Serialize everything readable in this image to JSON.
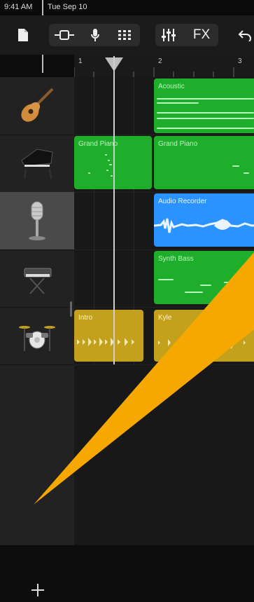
{
  "status": {
    "time": "9:41 AM",
    "date": "Tue Sep 10"
  },
  "toolbar": {
    "items": [
      {
        "name": "my-songs-icon"
      },
      {
        "name": "view-switcher-icon"
      },
      {
        "name": "microphone-icon"
      },
      {
        "name": "grid-view-icon"
      },
      {
        "name": "mixer-icon"
      },
      {
        "label": "FX"
      },
      {
        "name": "undo-icon"
      }
    ]
  },
  "ruler": {
    "marks": [
      "1",
      "2",
      "3"
    ]
  },
  "tracks": [
    {
      "instrument": "Acoustic Guitar",
      "icon": "acoustic-guitar-icon"
    },
    {
      "instrument": "Grand Piano",
      "icon": "grand-piano-icon"
    },
    {
      "instrument": "Audio Recorder",
      "icon": "microphone-stand-icon",
      "selected": true
    },
    {
      "instrument": "Synth Bass",
      "icon": "synth-keyboard-icon"
    },
    {
      "instrument": "Drums",
      "icon": "drum-kit-icon"
    }
  ],
  "regions": {
    "acoustic": "Acoustic",
    "piano1": "Grand Piano",
    "piano2": "Grand Piano",
    "audio": "Audio Recorder",
    "synth": "Synth Bass",
    "intro": "Intro",
    "kyle": "Kyle"
  },
  "colors": {
    "green": "#1fae2b",
    "blue": "#2b93ff",
    "yellow": "#c4a11d",
    "callout": "#f7a800"
  }
}
